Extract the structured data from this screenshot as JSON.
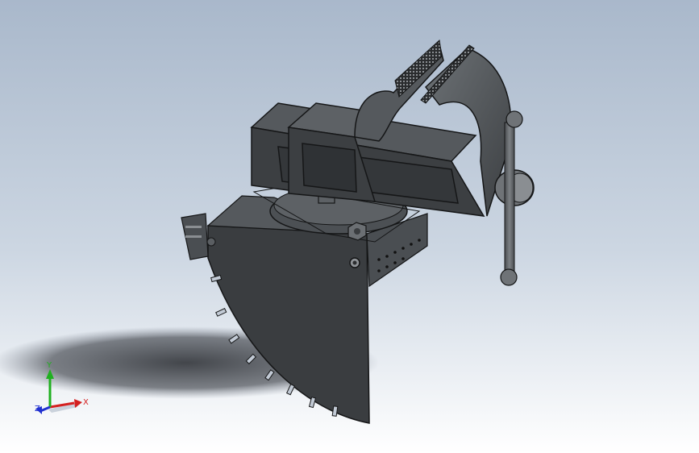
{
  "triad": {
    "x_label": "X",
    "y_label": "Y",
    "z_label": "Z"
  },
  "colors": {
    "background_top": "#a9b8cb",
    "background_bottom": "#ffffff",
    "model_dark": "#3c3f42",
    "model_mid": "#55595d",
    "model_light": "#6d7276",
    "edge": "#151617",
    "axis_x": "#d42020",
    "axis_y": "#20b020",
    "axis_z": "#2030d0"
  }
}
